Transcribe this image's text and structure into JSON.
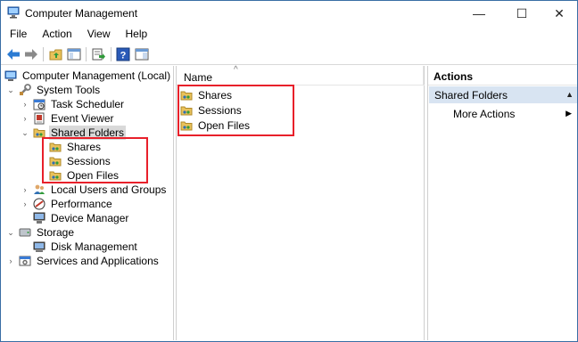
{
  "window": {
    "title": "Computer Management",
    "controls": {
      "minimize": "—",
      "maximize": "☐",
      "close": "✕"
    }
  },
  "menu": {
    "items": [
      "File",
      "Action",
      "View",
      "Help"
    ]
  },
  "toolbar": {
    "icons": [
      "back-arrow-icon",
      "forward-arrow-icon",
      "up-folder-icon",
      "show-hide-tree-icon",
      "export-list-icon",
      "help-icon",
      "properties-icon"
    ]
  },
  "tree": {
    "root": "Computer Management (Local)",
    "system_tools": "System Tools",
    "task_scheduler": "Task Scheduler",
    "event_viewer": "Event Viewer",
    "shared_folders": "Shared Folders",
    "shares": "Shares",
    "sessions": "Sessions",
    "open_files": "Open Files",
    "local_users": "Local Users and Groups",
    "performance": "Performance",
    "device_manager": "Device Manager",
    "storage": "Storage",
    "disk_management": "Disk Management",
    "services_apps": "Services and Applications"
  },
  "list": {
    "column_name": "Name",
    "sort_indicator": "^",
    "items": [
      "Shares",
      "Sessions",
      "Open Files"
    ]
  },
  "actions": {
    "title": "Actions",
    "section": "Shared Folders",
    "section_arrow": "▲",
    "more_actions": "More Actions",
    "more_arrow": "▶"
  },
  "colors": {
    "highlight": "#e8202a",
    "section_bg": "#d8e4f2",
    "selected_bg": "#d9d9d9"
  }
}
